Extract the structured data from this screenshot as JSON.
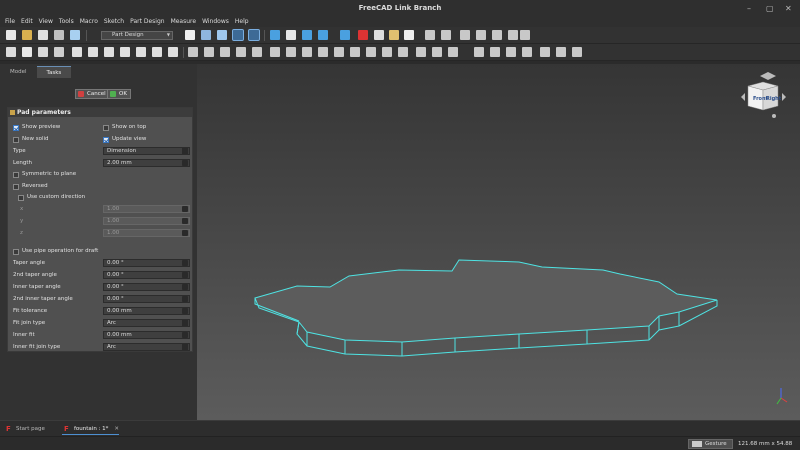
{
  "window": {
    "title": "FreeCAD Link Branch"
  },
  "menu": [
    "File",
    "Edit",
    "View",
    "Tools",
    "Macro",
    "Sketch",
    "Part Design",
    "Measure",
    "Windows",
    "Help"
  ],
  "toolbar": {
    "workbench": "Part Design"
  },
  "tabs": {
    "model": "Model",
    "tasks": "Tasks"
  },
  "dialog": {
    "cancel": "Cancel",
    "ok": "OK"
  },
  "pad": {
    "title": "Pad parameters",
    "show_preview": "Show preview",
    "show_on_top": "Show on top",
    "new_solid": "New solid",
    "update_view": "Update view",
    "type_label": "Type",
    "type_value": "Dimension",
    "length_label": "Length",
    "length_value": "2.00 mm",
    "symmetric": "Symmetric to plane",
    "reversed": "Reversed",
    "custom_direction": "Use custom direction",
    "x_label": "x",
    "y_label": "y",
    "z_label": "z",
    "x_value": "1.00",
    "y_value": "1.00",
    "z_value": "1.00",
    "pipe_draft": "Use pipe operation for draft",
    "rows": [
      {
        "label": "Taper angle",
        "value": "0.00 °",
        "kind": "spin"
      },
      {
        "label": "2nd taper angle",
        "value": "0.00 °",
        "kind": "spin"
      },
      {
        "label": "Inner taper angle",
        "value": "0.00 °",
        "kind": "spin"
      },
      {
        "label": "2nd inner taper angle",
        "value": "0.00 °",
        "kind": "spin"
      },
      {
        "label": "Fit tolerance",
        "value": "0.00 mm",
        "kind": "spin"
      },
      {
        "label": "Fit join type",
        "value": "Arc",
        "kind": "combo"
      },
      {
        "label": "Inner fit",
        "value": "0.00 mm",
        "kind": "spin"
      },
      {
        "label": "Inner fit join type",
        "value": "Arc",
        "kind": "combo"
      }
    ]
  },
  "doc_tabs": {
    "start": "Start page",
    "fountain": "fountain : 1*"
  },
  "status": {
    "nav": "Gesture",
    "dimensions": "121.68 mm x 54.88 mm"
  },
  "navcube": {
    "front": "Front",
    "right": "Right"
  },
  "colors": {
    "accent": "#4d8fd1",
    "model_edge": "#4ee3e3",
    "model_face": "#5b5b5b"
  }
}
